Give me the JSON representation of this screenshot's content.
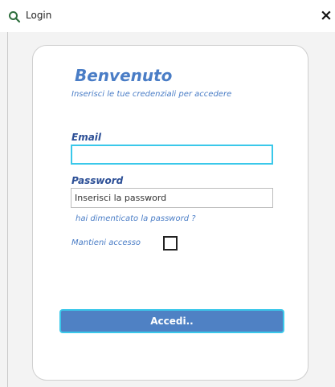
{
  "window": {
    "title": "Login",
    "close_label": "×",
    "app_icon": "search-icon"
  },
  "login": {
    "heading": "Benvenuto",
    "subtitle": "Inserisci le tue credenziali per accedere",
    "email_label": "Email",
    "email_value": "",
    "password_label": "Password",
    "password_placeholder": "Inserisci la password",
    "forgot_link": "hai dimenticato la password ?",
    "keep_label": "Mantieni accesso",
    "keep_checked": false,
    "submit_label": "Accedi.."
  },
  "colors": {
    "accent": "#4a7dc6",
    "label_dark": "#2c4f96",
    "focus_border": "#3ac8ea",
    "button_bg": "#4f81c4"
  }
}
